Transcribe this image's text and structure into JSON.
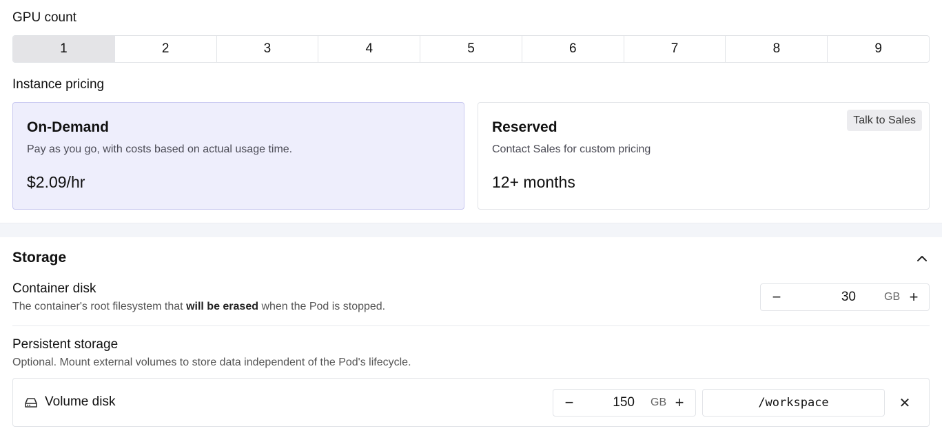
{
  "gpu": {
    "label": "GPU count",
    "options": [
      "1",
      "2",
      "3",
      "4",
      "5",
      "6",
      "7",
      "8",
      "9"
    ],
    "selected": "1"
  },
  "pricing": {
    "label": "Instance pricing",
    "on_demand": {
      "title": "On-Demand",
      "description": "Pay as you go, with costs based on actual usage time.",
      "price": "$2.09/hr"
    },
    "reserved": {
      "title": "Reserved",
      "description": "Contact Sales for custom pricing",
      "term": "12+ months",
      "sales_button": "Talk to Sales"
    }
  },
  "storage": {
    "title": "Storage",
    "container_disk": {
      "title": "Container disk",
      "desc_before": "The container's root filesystem that ",
      "desc_bold": "will be erased",
      "desc_after": " when the Pod is stopped.",
      "value": "30",
      "unit": "GB",
      "minus": "−",
      "plus": "+"
    },
    "persistent": {
      "title": "Persistent storage",
      "description": "Optional. Mount external volumes to store data independent of the Pod's lifecycle.",
      "volume": {
        "label": "Volume disk",
        "icon": "hard-drive-icon",
        "value": "150",
        "unit": "GB",
        "minus": "−",
        "plus": "+",
        "mount_path": "/workspace",
        "remove": "✕"
      }
    }
  },
  "colors": {
    "selected_card_bg": "#eeeefc",
    "selected_card_border": "#c8c8f0",
    "selected_segment_bg": "#e4e4e7"
  }
}
